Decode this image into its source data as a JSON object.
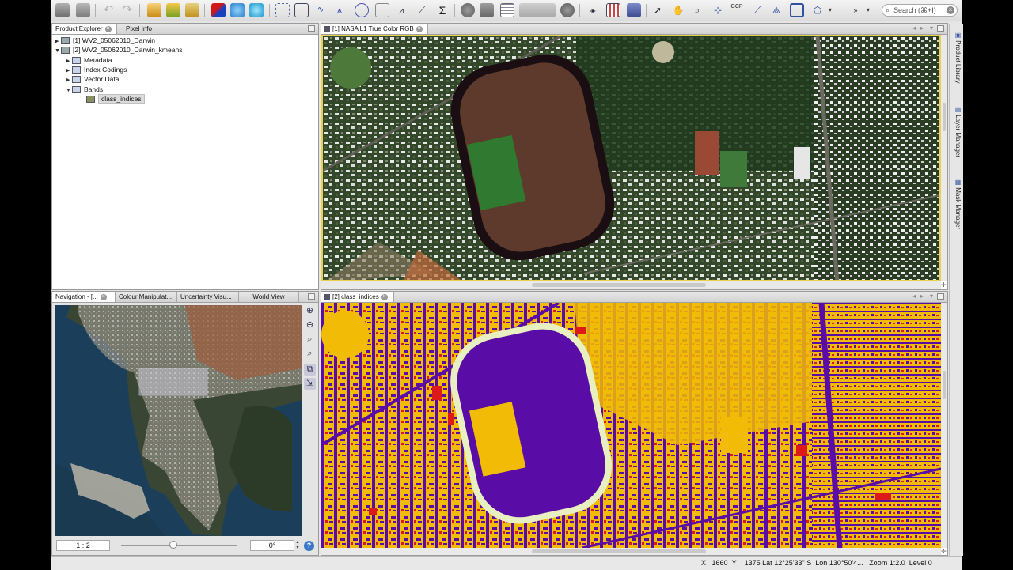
{
  "toolbar": {
    "search_placeholder": "Search (⌘+I)",
    "icons": [
      "new-product-icon",
      "save-icon",
      "undo-icon",
      "redo-icon",
      "open-icon",
      "import-icon",
      "export-icon",
      "band-maths-icon",
      "rgb-icon",
      "histogram-icon",
      "pin-icon",
      "statistics-icon",
      "scatter-icon",
      "profile-icon",
      "spectrum-icon",
      "sum-icon",
      "zoom-tool-icon",
      "pan-icon",
      "select-icon",
      "range-finder-icon",
      "gcp-icon"
    ],
    "gcp_label": "GCP"
  },
  "product_explorer": {
    "tabs": [
      {
        "label": "Product Explorer"
      },
      {
        "label": "Pixel Info"
      }
    ],
    "tree": [
      {
        "label": "[1] WV2_05062010_Darwin"
      },
      {
        "label": "[2] WV2_05062010_Darwin_kmeans"
      },
      {
        "label": "Metadata"
      },
      {
        "label": "Index Codings"
      },
      {
        "label": "Vector Data"
      },
      {
        "label": "Bands"
      },
      {
        "label": "class_indices"
      }
    ]
  },
  "navigation": {
    "tabs": [
      {
        "label": "Navigation - [..."
      },
      {
        "label": "Colour Manipulat..."
      },
      {
        "label": "Uncertainty Visu..."
      },
      {
        "label": "World View"
      }
    ],
    "zoom_ratio": "1 : 2",
    "rotation": "0°",
    "slider_value": 0.45,
    "help_label": "?"
  },
  "views": {
    "top": {
      "title": "[1] NASA L1 True Color RGB"
    },
    "bottom": {
      "title": "[2] class_indices"
    }
  },
  "right_strip": [
    "Product Library",
    "Layer Manager",
    "Mask Manager"
  ],
  "status": {
    "x_label": "X",
    "x_value": "1660",
    "y_label": "Y",
    "y_value": "1375",
    "lat_label": "Lat",
    "lat_value": "12°25'33\" S",
    "lon_label": "Lon",
    "lon_value": "130°50'4...",
    "zoom_label": "Zoom",
    "zoom_value": "1:2.0",
    "level_label": "Level",
    "level_value": "0"
  },
  "colors": {
    "class_purple": "#5a0ca6",
    "class_yellow": "#f2bb05",
    "class_red": "#dd1a1a",
    "class_cream": "#e8efc0",
    "vegetation": "#2f4a22",
    "rooftop": "#e6e6e6",
    "sea": "#16374f"
  }
}
